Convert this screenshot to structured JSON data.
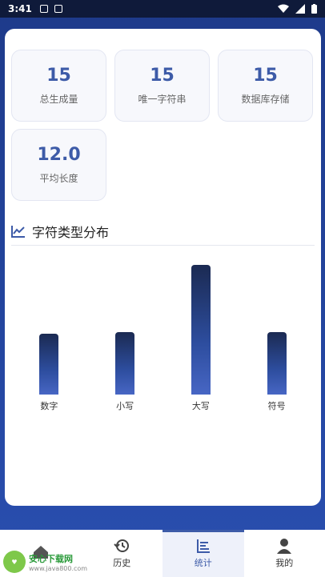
{
  "status_bar": {
    "time": "3:41"
  },
  "stats": [
    {
      "value": "15",
      "label": "总生成量"
    },
    {
      "value": "15",
      "label": "唯一字符串"
    },
    {
      "value": "15",
      "label": "数据库存储"
    },
    {
      "value": "12.0",
      "label": "平均长度"
    }
  ],
  "section": {
    "title": "字符类型分布"
  },
  "chart_data": {
    "type": "bar",
    "title": "字符类型分布",
    "categories": [
      "数字",
      "小写",
      "大写",
      "符号"
    ],
    "values": [
      3,
      3.1,
      6.4,
      3.1
    ],
    "ylim": [
      0,
      7
    ],
    "xlabel": "",
    "ylabel": "",
    "grid": false,
    "colors": [
      "#1b2a52",
      "#4766c4"
    ]
  },
  "nav": [
    {
      "label": "",
      "icon": "home-icon"
    },
    {
      "label": "历史",
      "icon": "history-icon"
    },
    {
      "label": "统计",
      "icon": "stats-icon"
    },
    {
      "label": "我的",
      "icon": "person-icon"
    }
  ],
  "watermark": {
    "main": "安心下载网",
    "sub": "www.java800.com"
  }
}
